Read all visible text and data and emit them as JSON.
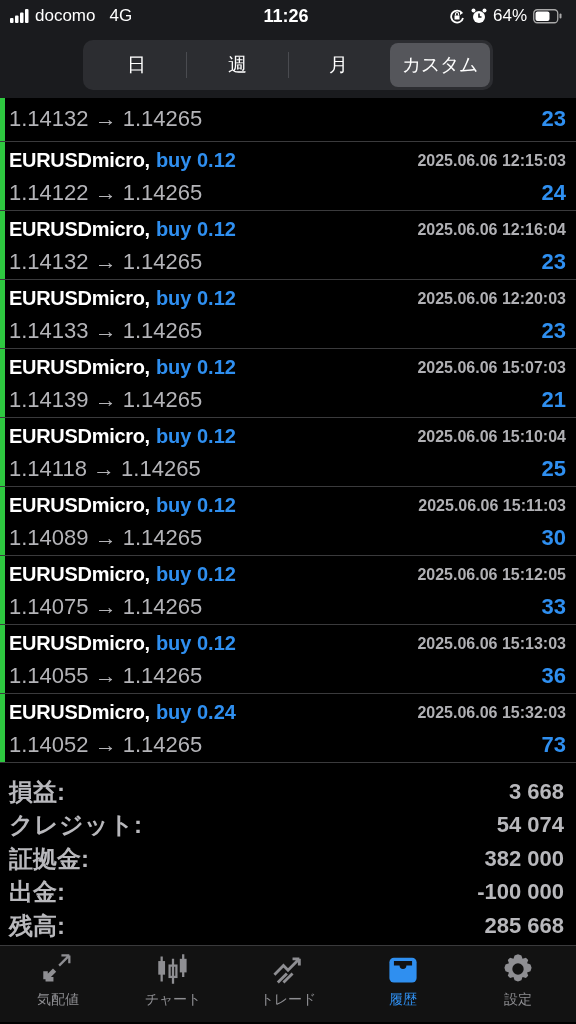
{
  "status_bar": {
    "carrier": "docomo",
    "network": "4G",
    "time": "11:26",
    "battery": "64%"
  },
  "period_tabs": [
    {
      "label": "日",
      "selected": false
    },
    {
      "label": "週",
      "selected": false
    },
    {
      "label": "月",
      "selected": false
    },
    {
      "label": "カスタム",
      "selected": true
    }
  ],
  "partial_deal": {
    "prices": "1.14132 → 1.14265",
    "profit": "23"
  },
  "deals": [
    {
      "symbol": "EURUSDmicro,",
      "order": "buy 0.12",
      "time": "2025.06.06 12:15:03",
      "prices": "1.14122 → 1.14265",
      "profit": "24"
    },
    {
      "symbol": "EURUSDmicro,",
      "order": "buy 0.12",
      "time": "2025.06.06 12:16:04",
      "prices": "1.14132 → 1.14265",
      "profit": "23"
    },
    {
      "symbol": "EURUSDmicro,",
      "order": "buy 0.12",
      "time": "2025.06.06 12:20:03",
      "prices": "1.14133 → 1.14265",
      "profit": "23"
    },
    {
      "symbol": "EURUSDmicro,",
      "order": "buy 0.12",
      "time": "2025.06.06 15:07:03",
      "prices": "1.14139 → 1.14265",
      "profit": "21"
    },
    {
      "symbol": "EURUSDmicro,",
      "order": "buy 0.12",
      "time": "2025.06.06 15:10:04",
      "prices": "1.14118 → 1.14265",
      "profit": "25"
    },
    {
      "symbol": "EURUSDmicro,",
      "order": "buy 0.12",
      "time": "2025.06.06 15:11:03",
      "prices": "1.14089 → 1.14265",
      "profit": "30"
    },
    {
      "symbol": "EURUSDmicro,",
      "order": "buy 0.12",
      "time": "2025.06.06 15:12:05",
      "prices": "1.14075 → 1.14265",
      "profit": "33"
    },
    {
      "symbol": "EURUSDmicro,",
      "order": "buy 0.12",
      "time": "2025.06.06 15:13:03",
      "prices": "1.14055 → 1.14265",
      "profit": "36"
    },
    {
      "symbol": "EURUSDmicro,",
      "order": "buy 0.24",
      "time": "2025.06.06 15:32:03",
      "prices": "1.14052 → 1.14265",
      "profit": "73"
    }
  ],
  "summary": [
    {
      "label": "損益:",
      "value": "3 668"
    },
    {
      "label": "クレジット:",
      "value": "54 074"
    },
    {
      "label": "証拠金:",
      "value": "382 000"
    },
    {
      "label": "出金:",
      "value": "-100 000"
    },
    {
      "label": "残高:",
      "value": "285 668"
    }
  ],
  "tab_bar": [
    {
      "kind": "quotes",
      "label": "気配値",
      "selected": false
    },
    {
      "kind": "chart",
      "label": "チャート",
      "selected": false
    },
    {
      "kind": "trade",
      "label": "トレード",
      "selected": false
    },
    {
      "kind": "history",
      "label": "履歴",
      "selected": true
    },
    {
      "kind": "settings",
      "label": "設定",
      "selected": false
    }
  ]
}
